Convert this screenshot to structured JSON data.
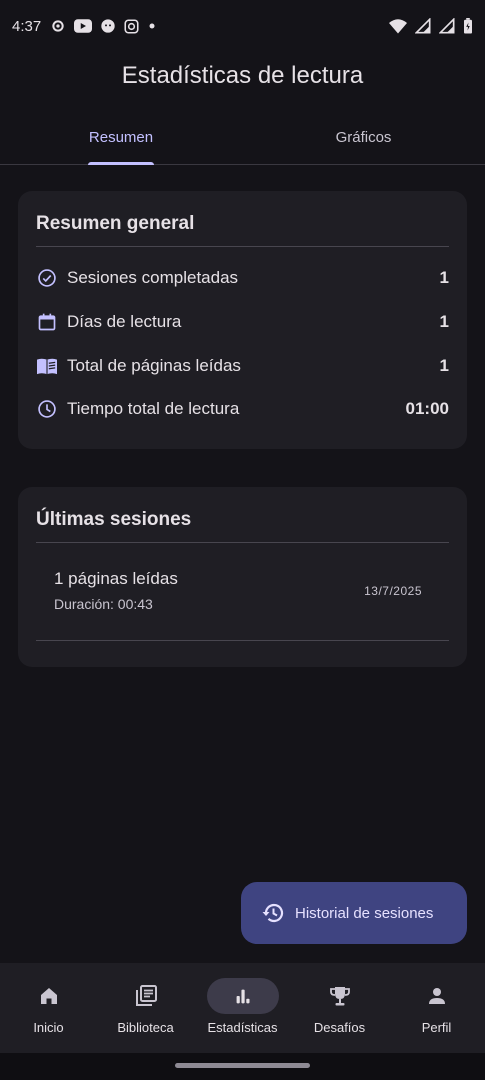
{
  "status": {
    "time": "4:37"
  },
  "header": {
    "title": "Estadísticas de lectura"
  },
  "tabs": [
    {
      "label": "Resumen",
      "active": true
    },
    {
      "label": "Gráficos",
      "active": false
    }
  ],
  "summary": {
    "title": "Resumen general",
    "rows": [
      {
        "icon": "check-circle-icon",
        "label": "Sesiones completadas",
        "value": "1"
      },
      {
        "icon": "calendar-icon",
        "label": "Días de lectura",
        "value": "1"
      },
      {
        "icon": "book-open-icon",
        "label": "Total de páginas leídas",
        "value": "1"
      },
      {
        "icon": "clock-icon",
        "label": "Tiempo total de lectura",
        "value": "01:00"
      }
    ]
  },
  "recent": {
    "title": "Últimas sesiones",
    "sessions": [
      {
        "title": "1 páginas leídas",
        "duration": "Duración: 00:43",
        "date": "13/7/2025"
      }
    ]
  },
  "fab": {
    "icon": "history-icon",
    "label": "Historial de sesiones"
  },
  "nav": [
    {
      "icon": "home-icon",
      "label": "Inicio",
      "active": false
    },
    {
      "icon": "library-icon",
      "label": "Biblioteca",
      "active": false
    },
    {
      "icon": "bar-chart-icon",
      "label": "Estadísticas",
      "active": true
    },
    {
      "icon": "trophy-icon",
      "label": "Desafíos",
      "active": false
    },
    {
      "icon": "person-icon",
      "label": "Perfil",
      "active": false
    }
  ],
  "colors": {
    "background": "#141318",
    "card": "#1f1e24",
    "accent": "#c3c0ff",
    "fab": "#3f4481"
  }
}
